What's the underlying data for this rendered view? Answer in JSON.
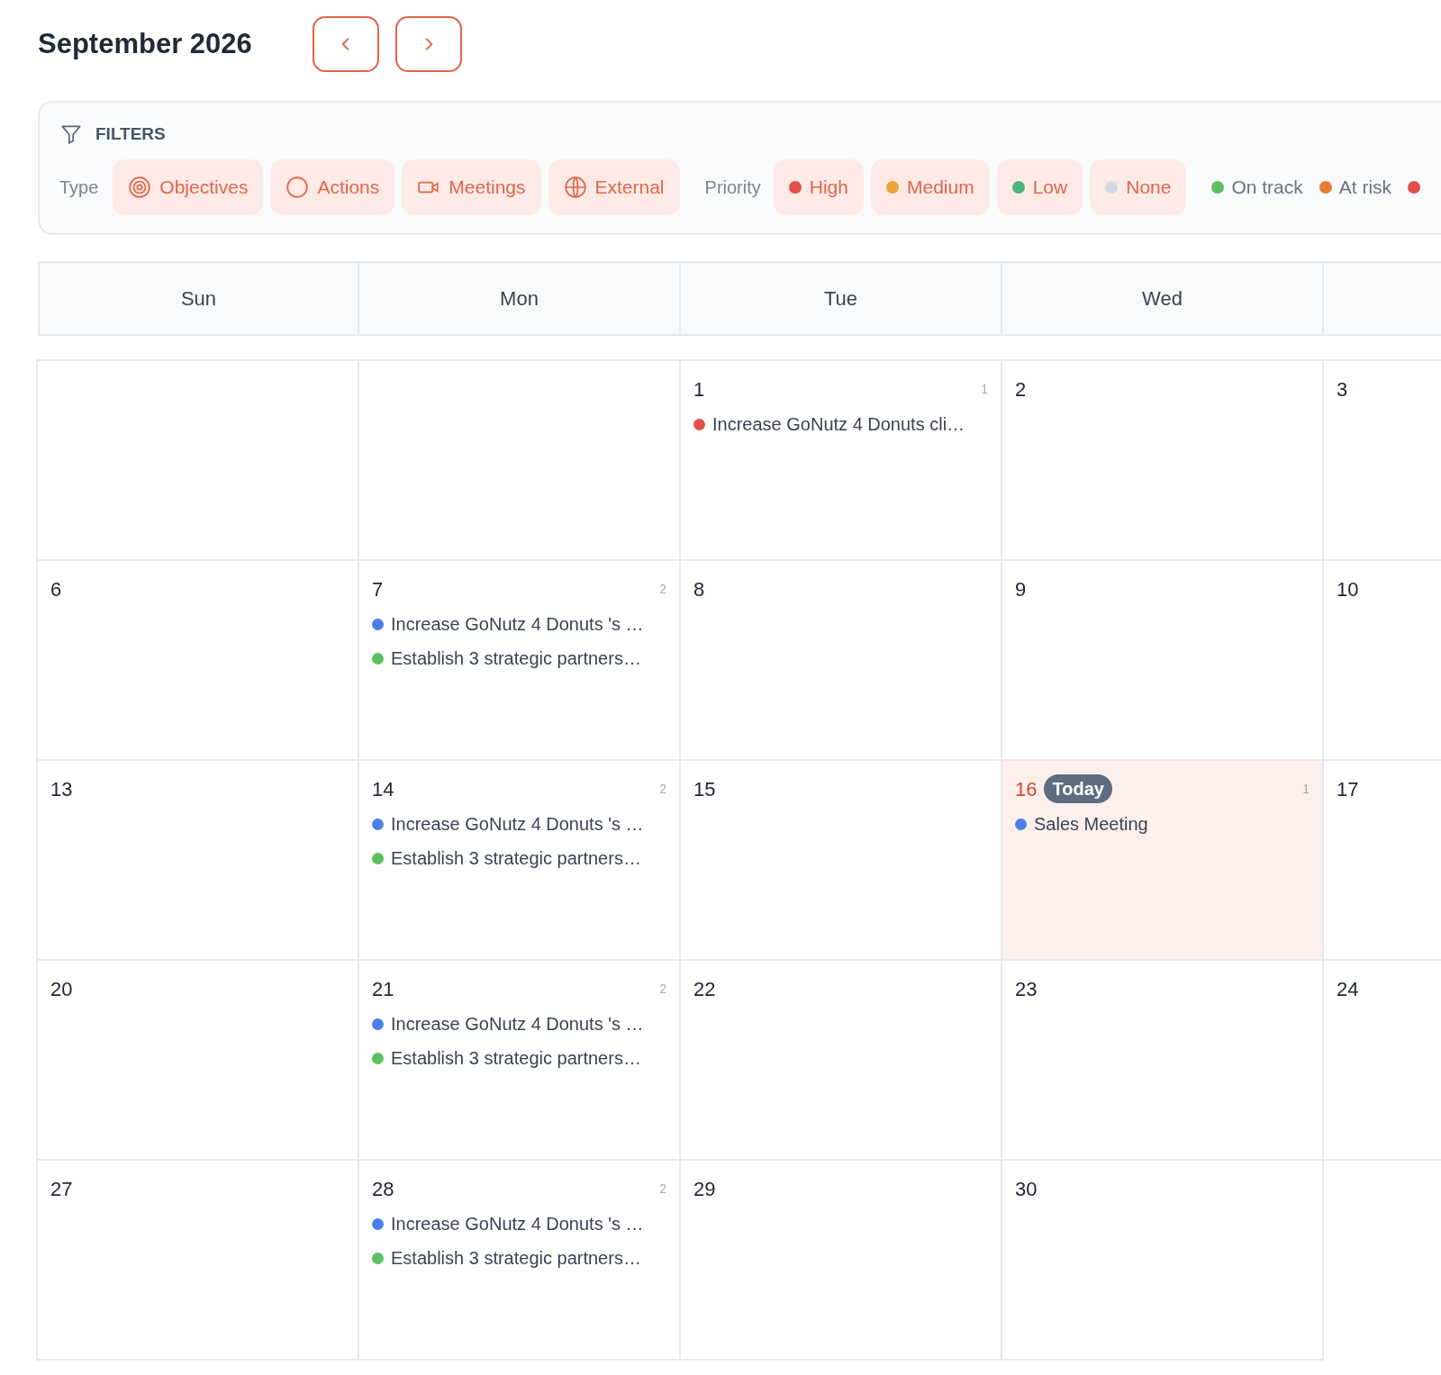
{
  "title": "September 2026",
  "nav": [
    {
      "kind": "prev"
    },
    {
      "kind": "next"
    }
  ],
  "filters": {
    "heading": "FILTERS",
    "type_label": "Type",
    "types": [
      {
        "kind": "objectives",
        "label": "Objectives",
        "selected": true
      },
      {
        "kind": "actions",
        "label": "Actions",
        "selected": true
      },
      {
        "kind": "meetings",
        "label": "Meetings",
        "selected": true
      },
      {
        "kind": "external",
        "label": "External",
        "selected": true
      }
    ],
    "priority_label": "Priority",
    "priorities": [
      {
        "label": "High",
        "color": "#e0504a",
        "selected": true
      },
      {
        "label": "Medium",
        "color": "#e9a43a",
        "selected": true
      },
      {
        "label": "Low",
        "color": "#4fb37f",
        "selected": true
      },
      {
        "label": "None",
        "color": "#d3d9e1",
        "selected": true
      }
    ],
    "statuses": [
      {
        "label": "On track",
        "color": "#5cc063",
        "selected": false
      },
      {
        "label": "At risk",
        "color": "#ea7a34",
        "selected": false
      },
      {
        "color": "#e0504a",
        "selected": false
      }
    ]
  },
  "weekdays": [
    "Sun",
    "Mon",
    "Tue",
    "Wed"
  ],
  "weeks": [
    [
      {
        "date": "1",
        "count": "1",
        "today": false,
        "events": [
          {
            "title": "Increase GoNutz 4 Donuts cli…",
            "color": "#e0504a"
          }
        ]
      },
      {
        "date": "2",
        "today": false
      },
      {
        "date": "3",
        "today": false
      }
    ],
    [
      {
        "date": "6",
        "today": false
      },
      {
        "date": "7",
        "count": "2",
        "today": false,
        "events": [
          {
            "title": "Increase GoNutz 4 Donuts 's …",
            "color": "#4a7fe8"
          },
          {
            "title": "Establish 3 strategic partners…",
            "color": "#5cc063"
          }
        ]
      },
      {
        "date": "8",
        "today": false
      },
      {
        "date": "9",
        "today": false
      },
      {
        "date": "10",
        "today": false
      }
    ],
    [
      {
        "date": "13",
        "today": false
      },
      {
        "date": "14",
        "count": "2",
        "today": false,
        "events": [
          {
            "title": "Increase GoNutz 4 Donuts 's …",
            "color": "#4a7fe8"
          },
          {
            "title": "Establish 3 strategic partners…",
            "color": "#5cc063"
          }
        ]
      },
      {
        "date": "15",
        "today": false
      },
      {
        "date": "16",
        "count": "1",
        "today": true,
        "today_label": "Today",
        "events": [
          {
            "title": "Sales Meeting",
            "color": "#4a7fe8"
          }
        ]
      },
      {
        "date": "17",
        "today": false
      }
    ],
    [
      {
        "date": "20",
        "today": false
      },
      {
        "date": "21",
        "count": "2",
        "today": false,
        "events": [
          {
            "title": "Increase GoNutz 4 Donuts 's …",
            "color": "#4a7fe8"
          },
          {
            "title": "Establish 3 strategic partners…",
            "color": "#5cc063"
          }
        ]
      },
      {
        "date": "22",
        "today": false
      },
      {
        "date": "23",
        "today": false
      },
      {
        "date": "24",
        "today": false
      }
    ],
    [
      {
        "date": "27",
        "today": false
      },
      {
        "date": "28",
        "count": "2",
        "today": false,
        "events": [
          {
            "title": "Increase GoNutz 4 Donuts 's …",
            "color": "#4a7fe8"
          },
          {
            "title": "Establish 3 strategic partners…",
            "color": "#5cc063"
          }
        ]
      },
      {
        "date": "29",
        "today": false
      },
      {
        "date": "30",
        "today": false
      }
    ]
  ]
}
